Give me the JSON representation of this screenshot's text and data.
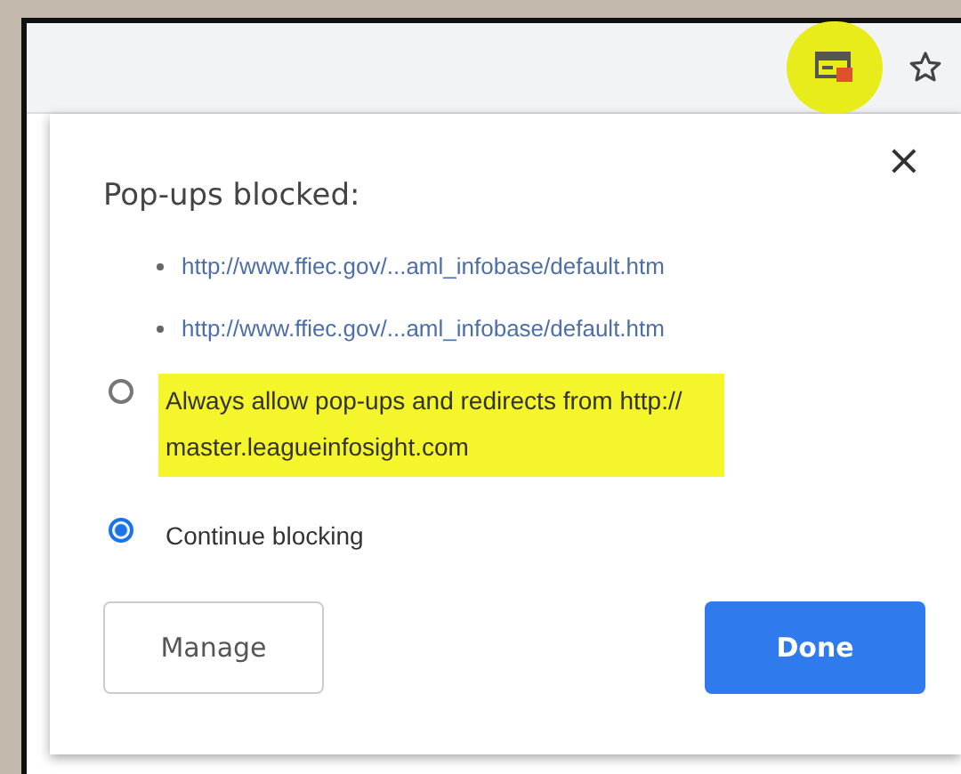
{
  "toolbar": {
    "popup_icon_highlighted": true
  },
  "dialog": {
    "title": "Pop-ups blocked:",
    "close": "×",
    "links": [
      "http://www.ffiec.gov/...aml_infobase/default.htm",
      "http://www.ffiec.gov/...aml_infobase/default.htm"
    ],
    "options": [
      {
        "label": "Always allow pop-ups and redirects from http://\nmaster.leagueinfosight.com",
        "selected": false,
        "highlighted": true
      },
      {
        "label": "Continue blocking",
        "selected": true,
        "highlighted": false
      }
    ],
    "buttons": [
      {
        "label": "Manage",
        "kind": "secondary"
      },
      {
        "label": "Done",
        "kind": "primary"
      }
    ]
  }
}
